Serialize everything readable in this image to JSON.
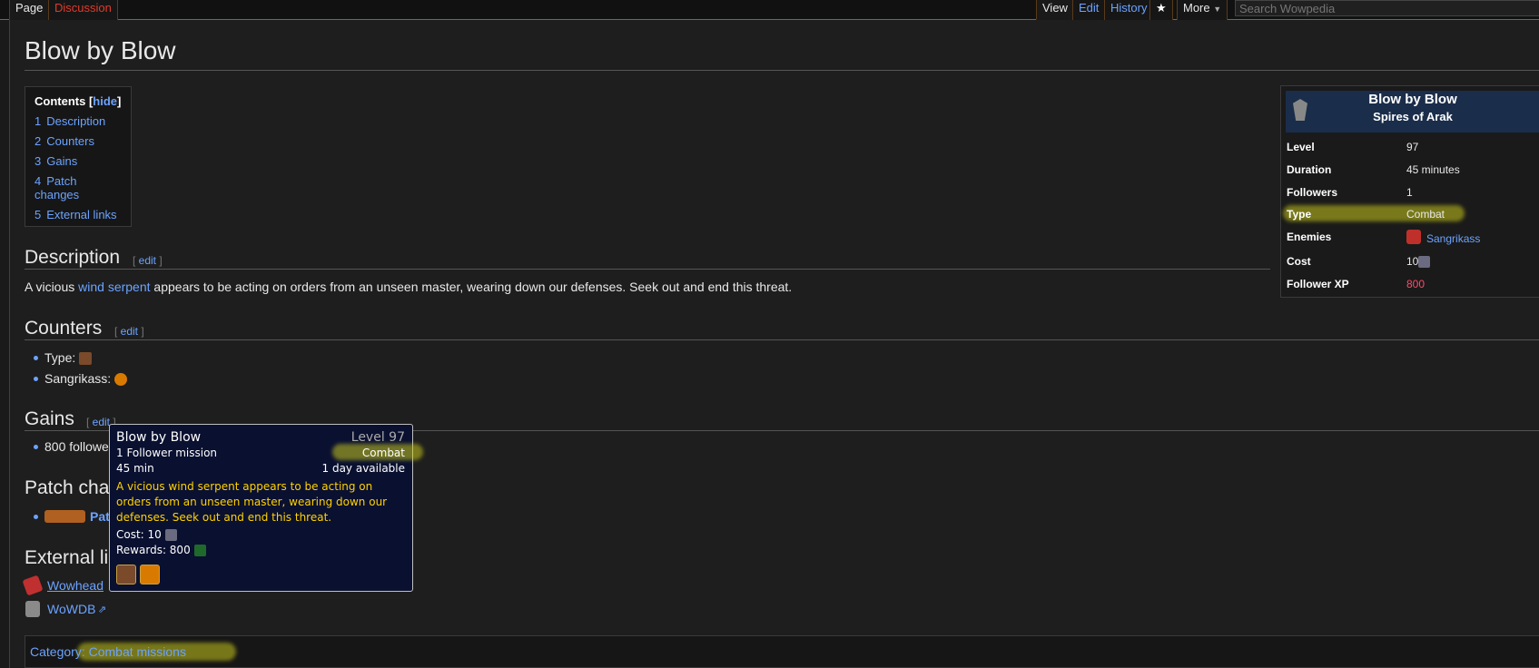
{
  "tabs": {
    "page": "Page",
    "discussion": "Discussion",
    "view": "View",
    "edit": "Edit",
    "history": "History",
    "more": "More"
  },
  "search": {
    "placeholder": "Search Wowpedia"
  },
  "page_title": "Blow by Blow",
  "toc": {
    "title": "Contents",
    "hide": "hide",
    "items": [
      {
        "num": "1",
        "label": "Description"
      },
      {
        "num": "2",
        "label": "Counters"
      },
      {
        "num": "3",
        "label": "Gains"
      },
      {
        "num": "4",
        "label": "Patch changes"
      },
      {
        "num": "5",
        "label": "External links"
      }
    ]
  },
  "sections": {
    "edit": "edit",
    "description": {
      "heading": "Description",
      "text_before": "A vicious ",
      "link": "wind serpent",
      "text_after": " appears to be acting on orders from an unseen master, wearing down our defenses. Seek out and end this threat."
    },
    "counters": {
      "heading": "Counters",
      "type_label": "Type:",
      "enemy_label": "Sangrikass:"
    },
    "gains": {
      "heading": "Gains",
      "item": "800 followe"
    },
    "patch": {
      "heading": "Patch cha",
      "link": "Pat"
    },
    "external": {
      "heading": "External li",
      "links": [
        "Wowhead",
        "WoWDB"
      ]
    }
  },
  "infobox": {
    "title": "Blow by Blow",
    "subtitle": "Spires of Arak",
    "rows": [
      {
        "label": "Level",
        "value": "97"
      },
      {
        "label": "Duration",
        "value": "45 minutes"
      },
      {
        "label": "Followers",
        "value": "1"
      },
      {
        "label": "Type",
        "value": "Combat"
      },
      {
        "label": "Enemies",
        "value": "Sangrikass"
      },
      {
        "label": "Cost",
        "value": "10"
      },
      {
        "label": "Follower XP",
        "value": "800"
      }
    ]
  },
  "tooltip": {
    "title": "Blow by Blow",
    "level": "Level 97",
    "followers": "1 Follower mission",
    "type": "Combat",
    "duration": "45 min",
    "availability": "1 day available",
    "description": "A vicious wind serpent appears to be acting on orders from an unseen master, wearing down our defenses. Seek out and end this threat.",
    "cost": "Cost: 10",
    "rewards": "Rewards: 800"
  },
  "category": {
    "label": "Category",
    "value": "Combat missions"
  },
  "colors": {
    "link": "#6ca3ff",
    "tooltip_desc": "#ffd200",
    "xp": "#ff4a6a",
    "highlight": "#c8c81e"
  }
}
